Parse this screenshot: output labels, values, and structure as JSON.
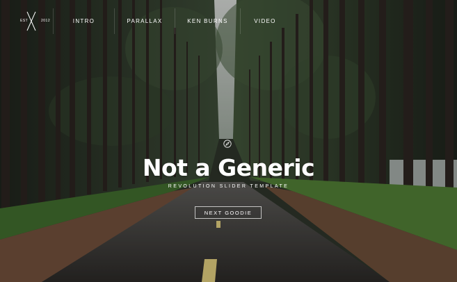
{
  "logo": {
    "est": "EST",
    "year": "2012"
  },
  "nav": {
    "items": [
      {
        "label": "INTRO"
      },
      {
        "label": "PARALLAX"
      },
      {
        "label": "KEN BURNS"
      },
      {
        "label": "VIDEO"
      }
    ]
  },
  "hero": {
    "icon": "compass-icon",
    "title": "Not a Generic",
    "subtitle": "REVOLUTION SLIDER TEMPLATE",
    "button_label": "NEXT GOODIE"
  },
  "colors": {
    "text": "#ffffff",
    "forest": "#2f3a2c",
    "road": "#3a3836",
    "grass": "#4f7a34"
  }
}
